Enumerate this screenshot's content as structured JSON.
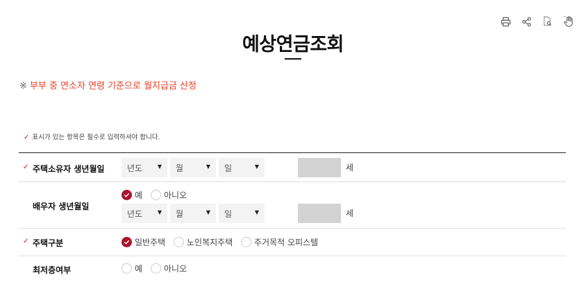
{
  "toolbar": {
    "icons": [
      "print-icon",
      "share-icon",
      "document-search-icon",
      "hand-pointer-icon"
    ]
  },
  "page": {
    "title": "예상연금조회",
    "notice_mark": "※",
    "notice": "부부 중 연소자 연령 기준으로 월지급금 산정",
    "required_note": "표시가 있는 항목은 필수로 입력하셔야 합니다."
  },
  "form": {
    "owner_birth": {
      "label": "주택소유자 생년월일",
      "year": "년도",
      "month": "월",
      "day": "일",
      "age_unit": "세"
    },
    "spouse_birth": {
      "label": "배우자 생년월일",
      "yes": "예",
      "no": "아니오",
      "year": "년도",
      "month": "월",
      "day": "일",
      "age_unit": "세"
    },
    "house_type": {
      "label": "주택구분",
      "opt1": "일반주택",
      "opt2": "노인복지주택",
      "opt3": "주거목적 오피스텔"
    },
    "lowest_floor": {
      "label": "최저층여부",
      "yes": "예",
      "no": "아니오"
    }
  }
}
